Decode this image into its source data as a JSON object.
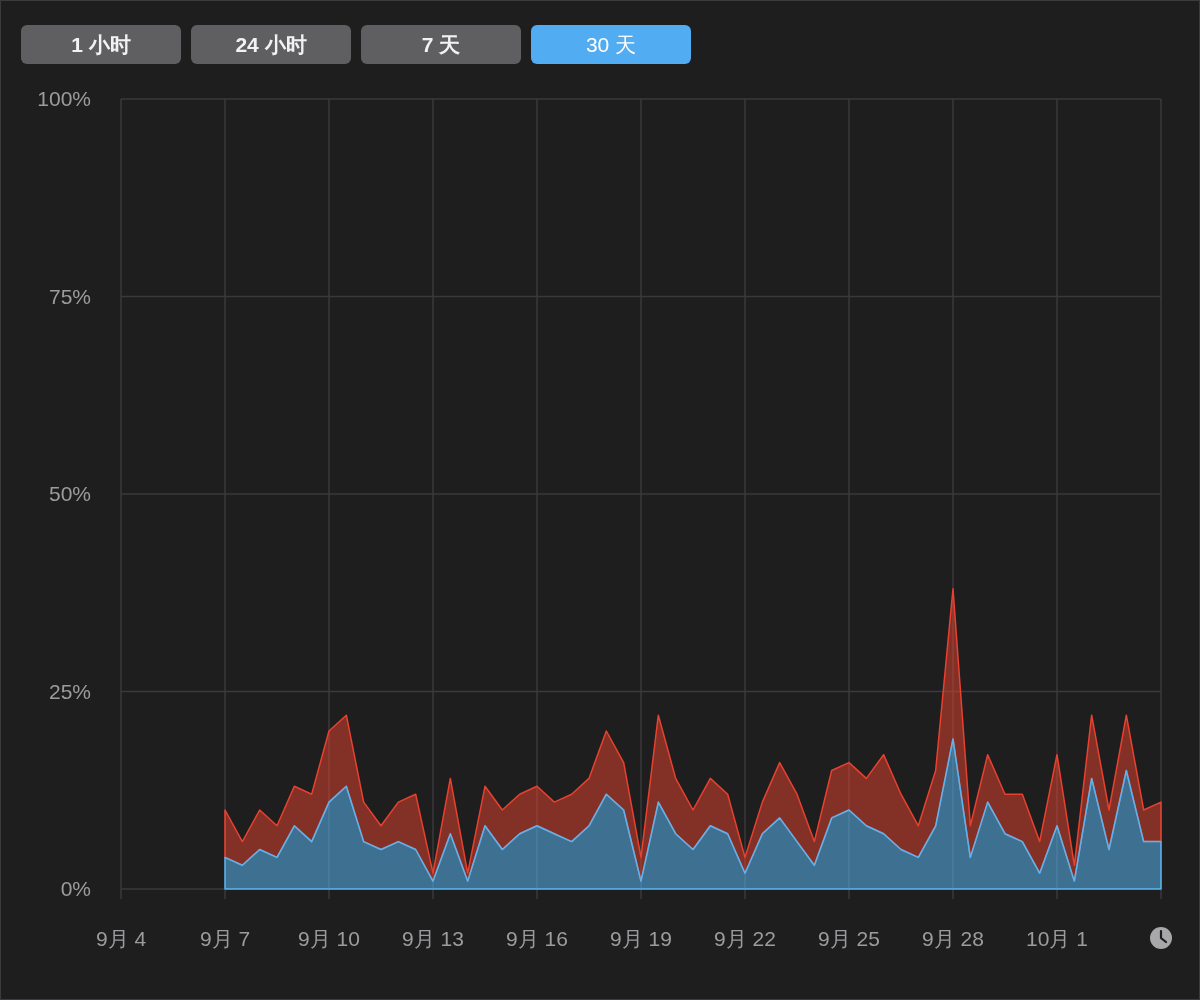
{
  "range_tabs": [
    {
      "label": "1 小时",
      "selected": false
    },
    {
      "label": "24 小时",
      "selected": false
    },
    {
      "label": "7 天",
      "selected": false
    },
    {
      "label": "30 天",
      "selected": true
    }
  ],
  "chart": {
    "chart_data": {
      "type": "area",
      "stacked": true,
      "grid": true,
      "ylim": [
        0,
        100
      ],
      "categories": [
        "9月 4",
        null,
        null,
        null,
        null,
        null,
        "9月 7",
        null,
        null,
        null,
        null,
        null,
        "9月 10",
        null,
        null,
        null,
        null,
        null,
        "9月 13",
        null,
        null,
        null,
        null,
        null,
        "9月 16",
        null,
        null,
        null,
        null,
        null,
        "9月 19",
        null,
        null,
        null,
        null,
        null,
        "9月 22",
        null,
        null,
        null,
        null,
        null,
        "9月 25",
        null,
        null,
        null,
        null,
        null,
        "9月 28",
        null,
        null,
        null,
        null,
        null,
        "10月 1",
        null,
        null,
        null,
        null,
        null,
        null
      ],
      "series": [
        {
          "color": "#5ab4f0",
          "values": [
            null,
            null,
            null,
            null,
            null,
            null,
            4,
            3,
            5,
            4,
            8,
            6,
            11,
            13,
            6,
            5,
            6,
            5,
            1,
            7,
            1,
            8,
            5,
            7,
            8,
            7,
            6,
            8,
            12,
            10,
            1,
            11,
            7,
            5,
            8,
            7,
            2,
            7,
            9,
            6,
            3,
            9,
            10,
            8,
            7,
            5,
            4,
            8,
            19,
            4,
            11,
            7,
            6,
            2,
            8,
            1,
            14,
            5,
            15,
            6,
            6
          ]
        },
        {
          "color": "#e8412f",
          "values": [
            null,
            null,
            null,
            null,
            null,
            null,
            6,
            3,
            5,
            4,
            5,
            6,
            9,
            9,
            5,
            3,
            5,
            7,
            1,
            7,
            1,
            5,
            5,
            5,
            5,
            4,
            6,
            6,
            8,
            6,
            3,
            11,
            7,
            5,
            6,
            5,
            2,
            4,
            7,
            6,
            3,
            6,
            6,
            6,
            10,
            7,
            4,
            7,
            19,
            4,
            6,
            5,
            6,
            4,
            9,
            2,
            8,
            5,
            7,
            4,
            5
          ]
        }
      ],
      "yticks": [
        {
          "value": 0,
          "label": "0%"
        },
        {
          "value": 25,
          "label": "25%"
        },
        {
          "value": 50,
          "label": "50%"
        },
        {
          "value": 75,
          "label": "75%"
        },
        {
          "value": 100,
          "label": "100%"
        }
      ]
    }
  }
}
